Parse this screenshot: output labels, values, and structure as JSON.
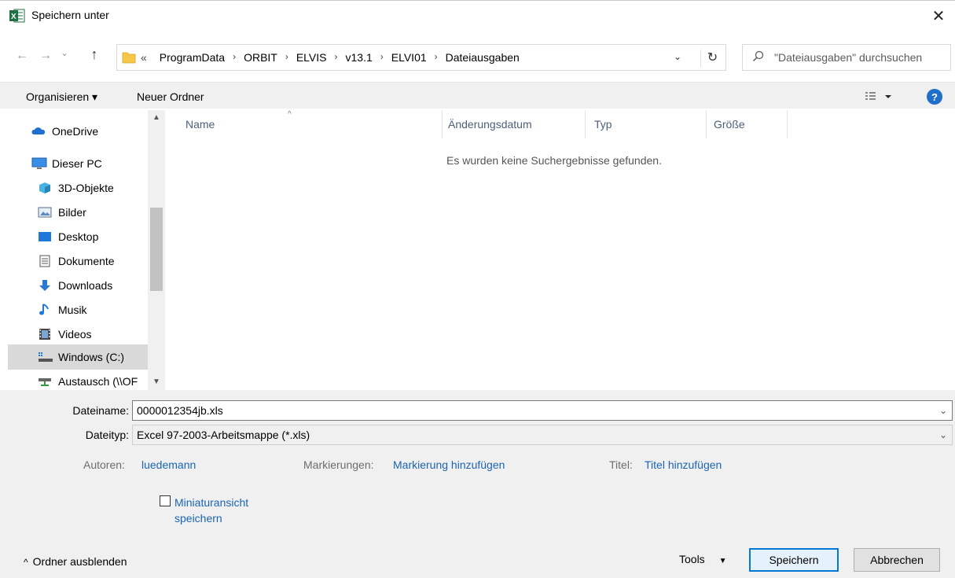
{
  "window": {
    "title": "Speichern unter",
    "app_icon": "excel-icon",
    "close_glyph": "✕"
  },
  "navigation": {
    "back_glyph": "←",
    "forward_glyph": "→",
    "recent_glyph": "⌄",
    "up_glyph": "↑"
  },
  "address": {
    "overflow": "«",
    "crumbs": [
      "ProgramData",
      "ORBIT",
      "ELVIS",
      "v13.1",
      "ELVI01",
      "Dateiausgaben"
    ],
    "separator": "›",
    "dropdown_glyph": "⌄",
    "refresh_glyph": "↻"
  },
  "search": {
    "placeholder": "\"Dateiausgaben\" durchsuchen"
  },
  "toolbar": {
    "organize_label": "Organisieren ▾",
    "new_folder_label": "Neuer Ordner",
    "help_label": "?"
  },
  "nav_pane": {
    "items": [
      {
        "label": "OneDrive",
        "icon": "cloud-icon"
      },
      {
        "label": "Dieser PC",
        "icon": "computer-icon"
      },
      {
        "label": "3D-Objekte",
        "icon": "cube-icon"
      },
      {
        "label": "Bilder",
        "icon": "pictures-icon"
      },
      {
        "label": "Desktop",
        "icon": "desktop-icon"
      },
      {
        "label": "Dokumente",
        "icon": "document-icon"
      },
      {
        "label": "Downloads",
        "icon": "download-icon"
      },
      {
        "label": "Musik",
        "icon": "music-icon"
      },
      {
        "label": "Videos",
        "icon": "video-icon"
      },
      {
        "label": "Windows (C:)",
        "icon": "drive-icon",
        "selected": true
      },
      {
        "label": "Austausch (\\\\OF",
        "icon": "network-drive-icon"
      }
    ]
  },
  "file_list": {
    "columns": [
      "Name",
      "Änderungsdatum",
      "Typ",
      "Größe"
    ],
    "sort_glyph": "^",
    "empty_message": "Es wurden keine Suchergebnisse gefunden."
  },
  "form": {
    "filename_label": "Dateiname:",
    "filename_value": "0000012354jb.xls",
    "filetype_label": "Dateityp:",
    "filetype_value": "Excel 97-2003-Arbeitsmappe (*.xls)",
    "authors_label": "Autoren:",
    "authors_value": "luedemann",
    "tags_label": "Markierungen:",
    "tags_value": "Markierung hinzufügen",
    "title_label": "Titel:",
    "title_value": "Titel hinzufügen",
    "thumbnail_line1": "Miniaturansicht",
    "thumbnail_line2": "speichern",
    "thumbnail_checked": false
  },
  "footer": {
    "hide_folders_label": "Ordner ausblenden",
    "hide_folders_glyph": "^",
    "tools_label": "Tools",
    "save_label": "Speichern",
    "cancel_label": "Abbrechen"
  },
  "colors": {
    "accent": "#0078d7",
    "link": "#1a64b4",
    "toolbar_bg": "#f0f0f0",
    "selected_nav_bg": "#d9d9d9"
  }
}
